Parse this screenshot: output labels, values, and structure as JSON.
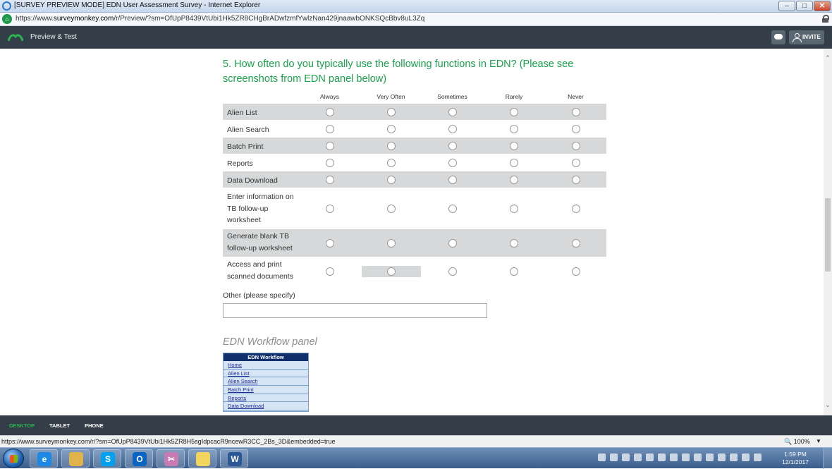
{
  "window": {
    "title": "[SURVEY PREVIEW MODE] EDN User Assessment Survey - Internet Explorer",
    "controls": {
      "minimize": "–",
      "maximize": "□",
      "close": "✕"
    }
  },
  "address_bar": {
    "url_prefix": "https://www.",
    "url_domain": "surveymonkey.com",
    "url_rest": "/r/Preview/?sm=OfUpP8439VtUbi1Hk5ZR8CHgBrADwfzmfYwlzNan429jnaawbONKSQcBbv8uL3Zq"
  },
  "survey_header": {
    "mode_label": "Preview & Test",
    "invite_label": "INVITE"
  },
  "question": {
    "number_and_text": "5. How often do you typically use the following functions in EDN? (Please see screenshots from EDN panel below)",
    "columns": [
      "Always",
      "Very Often",
      "Sometimes",
      "Rarely",
      "Never"
    ],
    "rows": [
      {
        "label": "Alien List",
        "shaded": true
      },
      {
        "label": "Alien Search",
        "shaded": false
      },
      {
        "label": "Batch Print",
        "shaded": true
      },
      {
        "label": "Reports",
        "shaded": false
      },
      {
        "label": "Data Download",
        "shaded": true
      },
      {
        "label": "Enter information on TB follow-up worksheet",
        "shaded": false
      },
      {
        "label": "Generate blank TB follow-up worksheet",
        "shaded": true
      },
      {
        "label": "Access and print scanned documents",
        "shaded": false
      }
    ],
    "other_label": "Other (please specify)",
    "other_value": ""
  },
  "workflow_panel": {
    "caption": "EDN Workflow panel",
    "header": "EDN Workflow",
    "links": [
      "Home",
      "Alien List",
      "Alien Search",
      "Batch Print",
      "Reports",
      "Data Download"
    ]
  },
  "device_bar": {
    "tabs": [
      "DESKTOP",
      "TABLET",
      "PHONE"
    ],
    "active": "DESKTOP"
  },
  "status_bar": {
    "url": "https://www.surveymonkey.com/r/?sm=OfUpP8439VtUbi1Hk5ZR8H5sgIdpcacR9ncewR3CC_2Bs_3D&embedded=true",
    "zoom": "100%"
  },
  "taskbar": {
    "time": "1:59 PM",
    "date": "12/1/2017",
    "apps": [
      {
        "name": "internet-explorer",
        "glyph": "e"
      },
      {
        "name": "file-explorer",
        "glyph": ""
      },
      {
        "name": "skype",
        "glyph": "S"
      },
      {
        "name": "outlook",
        "glyph": "O"
      },
      {
        "name": "snipping-tool",
        "glyph": "✂"
      },
      {
        "name": "sticky-notes",
        "glyph": ""
      },
      {
        "name": "word",
        "glyph": "W"
      }
    ]
  },
  "colors": {
    "accent_green": "#18a34a",
    "header_bg": "#333e48",
    "row_shade": "#d7d8d9",
    "workflow_header": "#10306c"
  }
}
